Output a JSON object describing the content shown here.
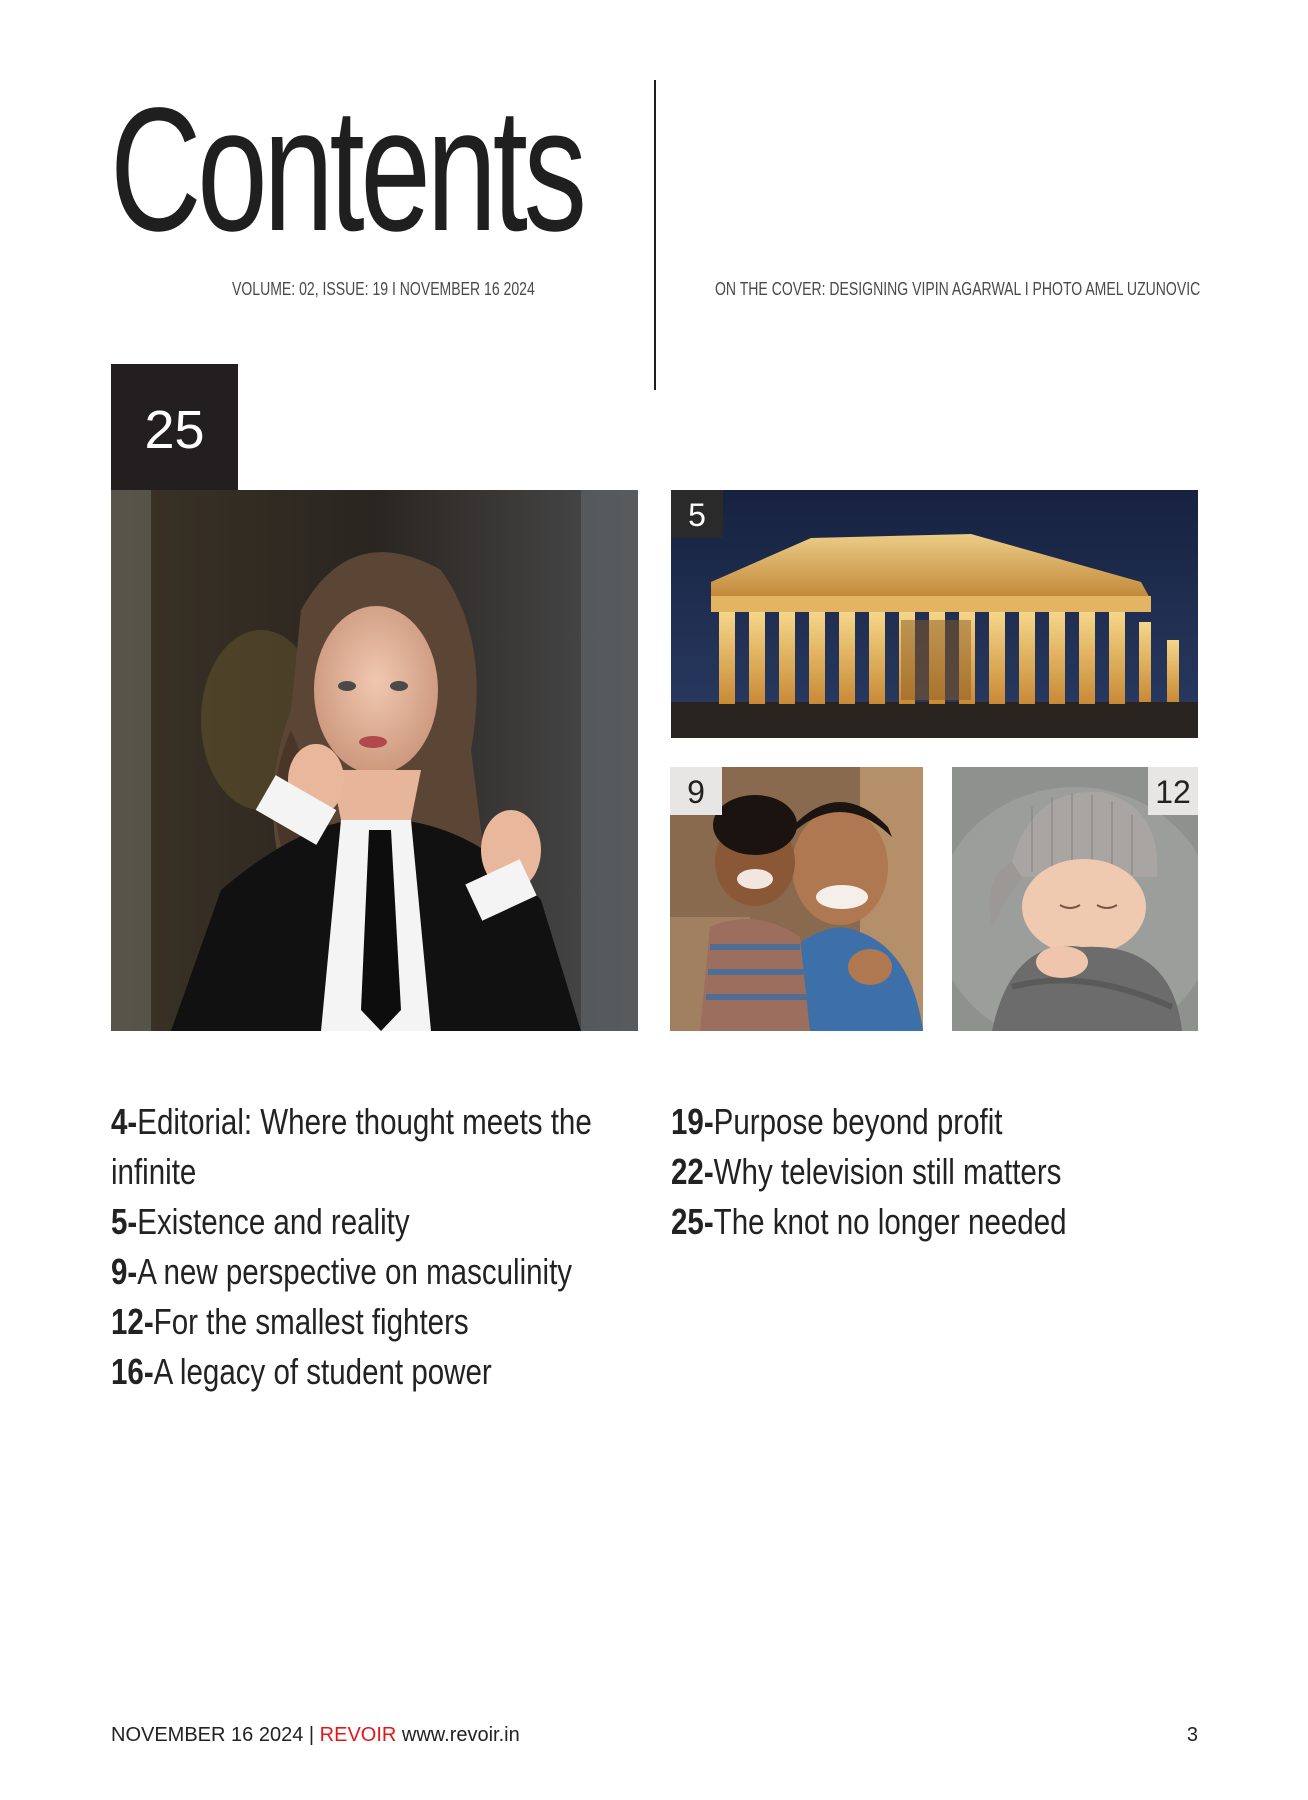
{
  "header": {
    "title": "Contents",
    "issue_line": "VOLUME: 02, ISSUE: 19  I  NOVEMBER 16 2024",
    "cover_credit": "ON THE COVER: DESIGNING VIPIN AGARWAL I  PHOTO AMEL UZUNOVIC"
  },
  "photos": {
    "main_page": "25",
    "temple_page": "5",
    "father_page": "9",
    "baby_page": "12"
  },
  "toc_left": [
    {
      "num": "4-",
      "title": "Editorial: Where thought meets the infinite"
    },
    {
      "num": "5-",
      "title": "Existence and reality"
    },
    {
      "num": "9-",
      "title": "A new perspective on masculinity"
    },
    {
      "num": "12-",
      "title": "For the smallest fighters"
    },
    {
      "num": "16-",
      "title": "A legacy of student power"
    }
  ],
  "toc_right": [
    {
      "num": "19-",
      "title": "Purpose beyond profit"
    },
    {
      "num": "22-",
      "title": "Why television still matters"
    },
    {
      "num": "25-",
      "title": "The knot no longer needed"
    }
  ],
  "footer": {
    "date": "NOVEMBER 16 2024",
    "separator": "|",
    "brand": "REVOIR",
    "url": "www.revoir.in",
    "page_number": "3"
  }
}
